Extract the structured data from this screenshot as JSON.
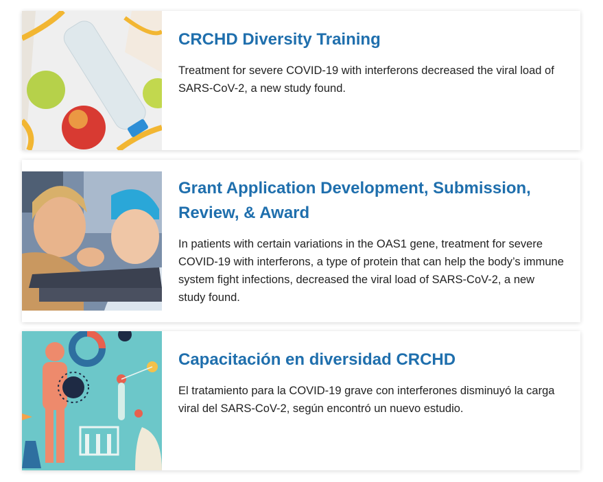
{
  "cards": [
    {
      "title": "CRCHD Diversity Training",
      "description": "Treatment for severe COVID-19 with interferons decreased the viral load of SARS-CoV-2, a new study found.",
      "image": "apples-water-bottle-measuring-tape-photo"
    },
    {
      "title": "Grant Application Development, Submission, Review, & Award",
      "description": "In patients with certain variations in the OAS1 gene, treatment for severe COVID-19 with interferons, a type of protein that can help the body’s immune system fight infections, decreased the viral load of SARS-CoV-2, a new study found.",
      "image": "two-smiling-children-waving-photo"
    },
    {
      "title": "Capacitación en diversidad CRCHD",
      "description": "El tratamiento para la COVID-19 grave con interferones disminuyó la carga viral del SARS-CoV-2, según encontró un nuevo estudio.",
      "image": "science-illustration-virus-human-figure"
    }
  ],
  "colors": {
    "title": "#1f6fad",
    "text": "#222222",
    "card_bg": "#ffffff"
  }
}
